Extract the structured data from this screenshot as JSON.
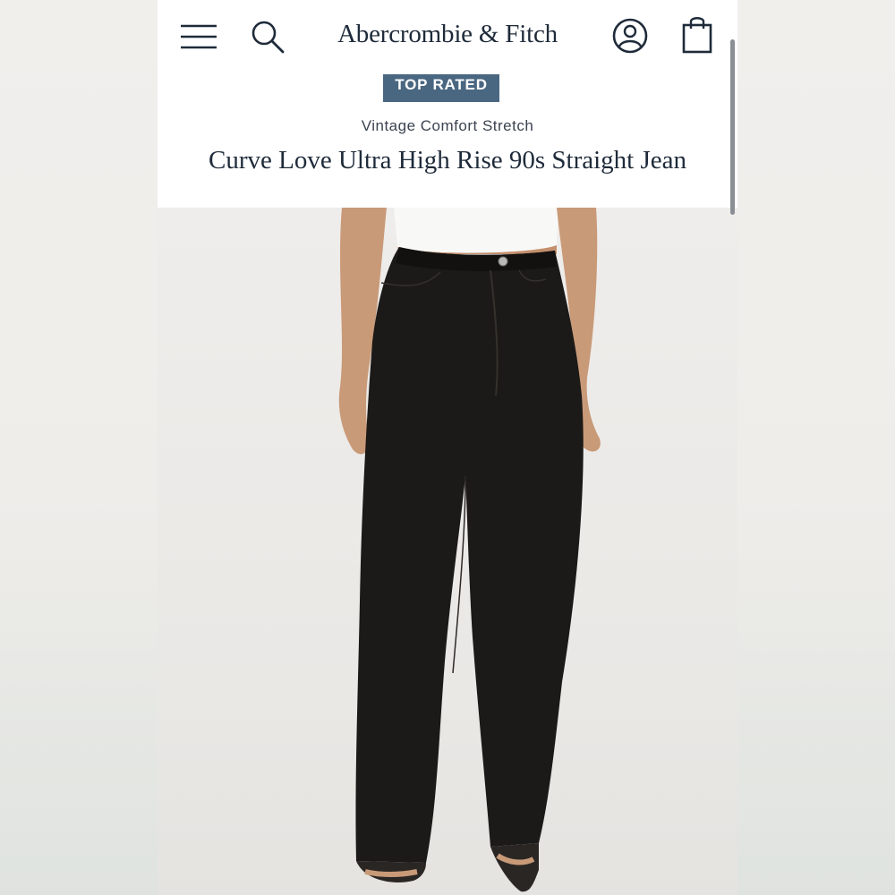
{
  "header": {
    "brand": "Abercrombie & Fitch",
    "icons": {
      "menu": "hamburger-menu-icon",
      "search": "search-icon",
      "account": "account-icon",
      "bag": "shopping-bag-icon"
    }
  },
  "product": {
    "badge": "TOP RATED",
    "collection": "Vintage Comfort Stretch",
    "title": "Curve Love Ultra High Rise 90s Straight Jean"
  },
  "colors": {
    "brand_text": "#1f2b3a",
    "badge_bg": "#4a6781",
    "jeans": "#1c1a18"
  }
}
